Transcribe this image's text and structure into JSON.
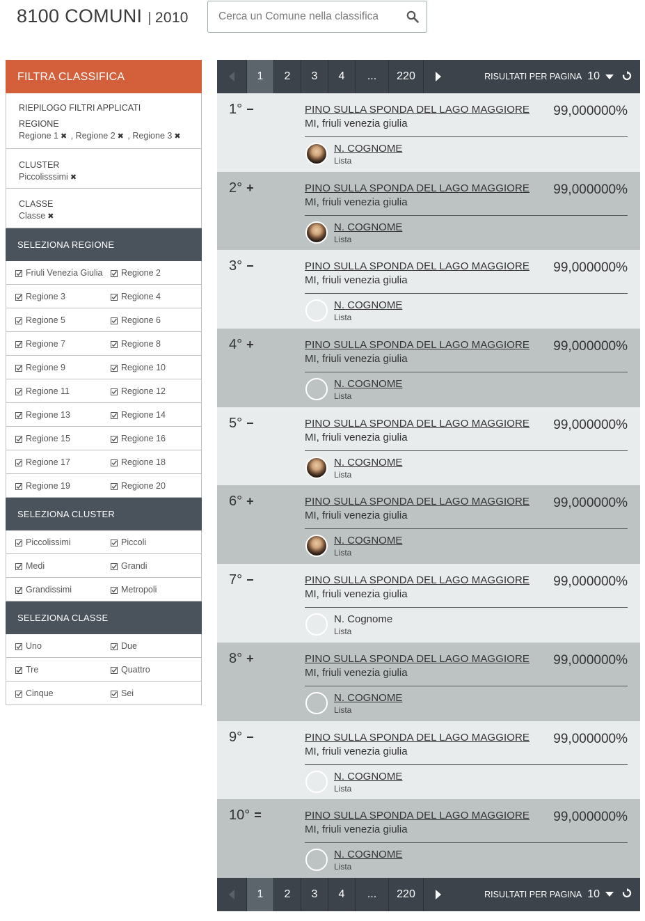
{
  "header": {
    "title": "8100 COMUNI",
    "separator": "|",
    "year": "2010",
    "search_placeholder": "Cerca un Comune nella classifica"
  },
  "sidebar": {
    "filter_title": "FILTRA CLASSIFICA",
    "summary_title": "RIEPILOGO FILTRI APPLICATI",
    "applied": [
      {
        "label": "REGIONE",
        "values": [
          "Regione 1",
          "Regione 2",
          "Regione 3"
        ]
      },
      {
        "label": "CLUSTER",
        "values": [
          "Piccolisssimi"
        ]
      },
      {
        "label": "CLASSE",
        "values": [
          "Classe"
        ]
      }
    ],
    "sections": [
      {
        "title": "SELEZIONA REGIONE",
        "options": [
          "Friuli Venezia Giulia",
          "Regione 2",
          "Regione 3",
          "Regione 4",
          "Regione 5",
          "Regione 6",
          "Regione 7",
          "Regione 8",
          "Regione 9",
          "Regione 10",
          "Regione 11",
          "Regione 12",
          "Regione 13",
          "Regione 14",
          "Regione 15",
          "Regione 16",
          "Regione 17",
          "Regione 18",
          "Regione 19",
          "Regione 20"
        ]
      },
      {
        "title": "SELEZIONA CLUSTER",
        "options": [
          "Piccolissimi",
          "Piccoli",
          "Medi",
          "Grandi",
          "Grandissimi",
          "Metropoli"
        ]
      },
      {
        "title": "SELEZIONA CLASSE",
        "options": [
          "Uno",
          "Due",
          "Tre",
          "Quattro",
          "Cinque",
          "Sei"
        ]
      }
    ]
  },
  "pager": {
    "pages": [
      "1",
      "2",
      "3",
      "4",
      "...",
      "220"
    ],
    "active_page": "1",
    "per_page_label": "RISULTATI PER PAGINA",
    "per_page_value": "10"
  },
  "results": [
    {
      "rank": "1°",
      "trend": "−",
      "city": "PINO SULLA SPONDA DEL LAGO MAGGIORE",
      "region": "MI, friuli venezia giulia",
      "pct": "99,000000%",
      "person": "N. COGNOME",
      "list": "Lista",
      "photo": true,
      "linked": true
    },
    {
      "rank": "2°",
      "trend": "+",
      "city": "PINO SULLA SPONDA DEL LAGO MAGGIORE",
      "region": "MI, friuli venezia giulia",
      "pct": "99,000000%",
      "person": "N. COGNOME",
      "list": "Lista",
      "photo": true,
      "linked": true
    },
    {
      "rank": "3°",
      "trend": "−",
      "city": "PINO SULLA SPONDA DEL LAGO MAGGIORE",
      "region": "MI, friuli venezia giulia",
      "pct": "99,000000%",
      "person": "N. COGNOME",
      "list": "Lista",
      "photo": false,
      "linked": true
    },
    {
      "rank": "4°",
      "trend": "+",
      "city": "PINO SULLA SPONDA DEL LAGO MAGGIORE",
      "region": "MI, friuli venezia giulia",
      "pct": "99,000000%",
      "person": "N. COGNOME",
      "list": "Lista",
      "photo": false,
      "linked": true
    },
    {
      "rank": "5°",
      "trend": "−",
      "city": "PINO SULLA SPONDA DEL LAGO MAGGIORE",
      "region": "MI, friuli venezia giulia",
      "pct": "99,000000%",
      "person": "N. COGNOME",
      "list": "Lista",
      "photo": true,
      "linked": true
    },
    {
      "rank": "6°",
      "trend": "+",
      "city": "PINO SULLA SPONDA DEL LAGO MAGGIORE",
      "region": "MI, friuli venezia giulia",
      "pct": "99,000000%",
      "person": "N. COGNOME",
      "list": "Lista",
      "photo": true,
      "linked": true
    },
    {
      "rank": "7°",
      "trend": "−",
      "city": "PINO SULLA SPONDA DEL LAGO MAGGIORE",
      "region": "MI, friuli venezia giulia",
      "pct": "99,000000%",
      "person": "N. Cognome",
      "list": "Lista",
      "photo": false,
      "linked": false
    },
    {
      "rank": "8°",
      "trend": "+",
      "city": "PINO SULLA SPONDA DEL LAGO MAGGIORE",
      "region": "MI, friuli venezia giulia",
      "pct": "99,000000%",
      "person": "N. COGNOME",
      "list": "Lista",
      "photo": false,
      "linked": true
    },
    {
      "rank": "9°",
      "trend": "−",
      "city": "PINO SULLA SPONDA DEL LAGO MAGGIORE",
      "region": "MI, friuli venezia giulia",
      "pct": "99,000000%",
      "person": "N. COGNOME",
      "list": "Lista",
      "photo": false,
      "linked": true
    },
    {
      "rank": "10°",
      "trend": "=",
      "city": "PINO SULLA SPONDA DEL LAGO MAGGIORE",
      "region": "MI, friuli venezia giulia",
      "pct": "99,000000%",
      "person": "N. COGNOME",
      "list": "Lista",
      "photo": false,
      "linked": true
    }
  ],
  "colors": {
    "accent": "#d35f3b",
    "section_header": "#4a525c",
    "pager_bg": "#3c434b",
    "row_light": "#e9eced",
    "row_dark": "#bcc3c2"
  },
  "icons": {
    "search": "search-icon",
    "remove": "close-icon",
    "checkbox": "checkbox-checked-icon",
    "prev": "chevron-left-icon",
    "next": "chevron-right-icon",
    "dropdown": "caret-down-icon",
    "refresh": "refresh-icon"
  }
}
